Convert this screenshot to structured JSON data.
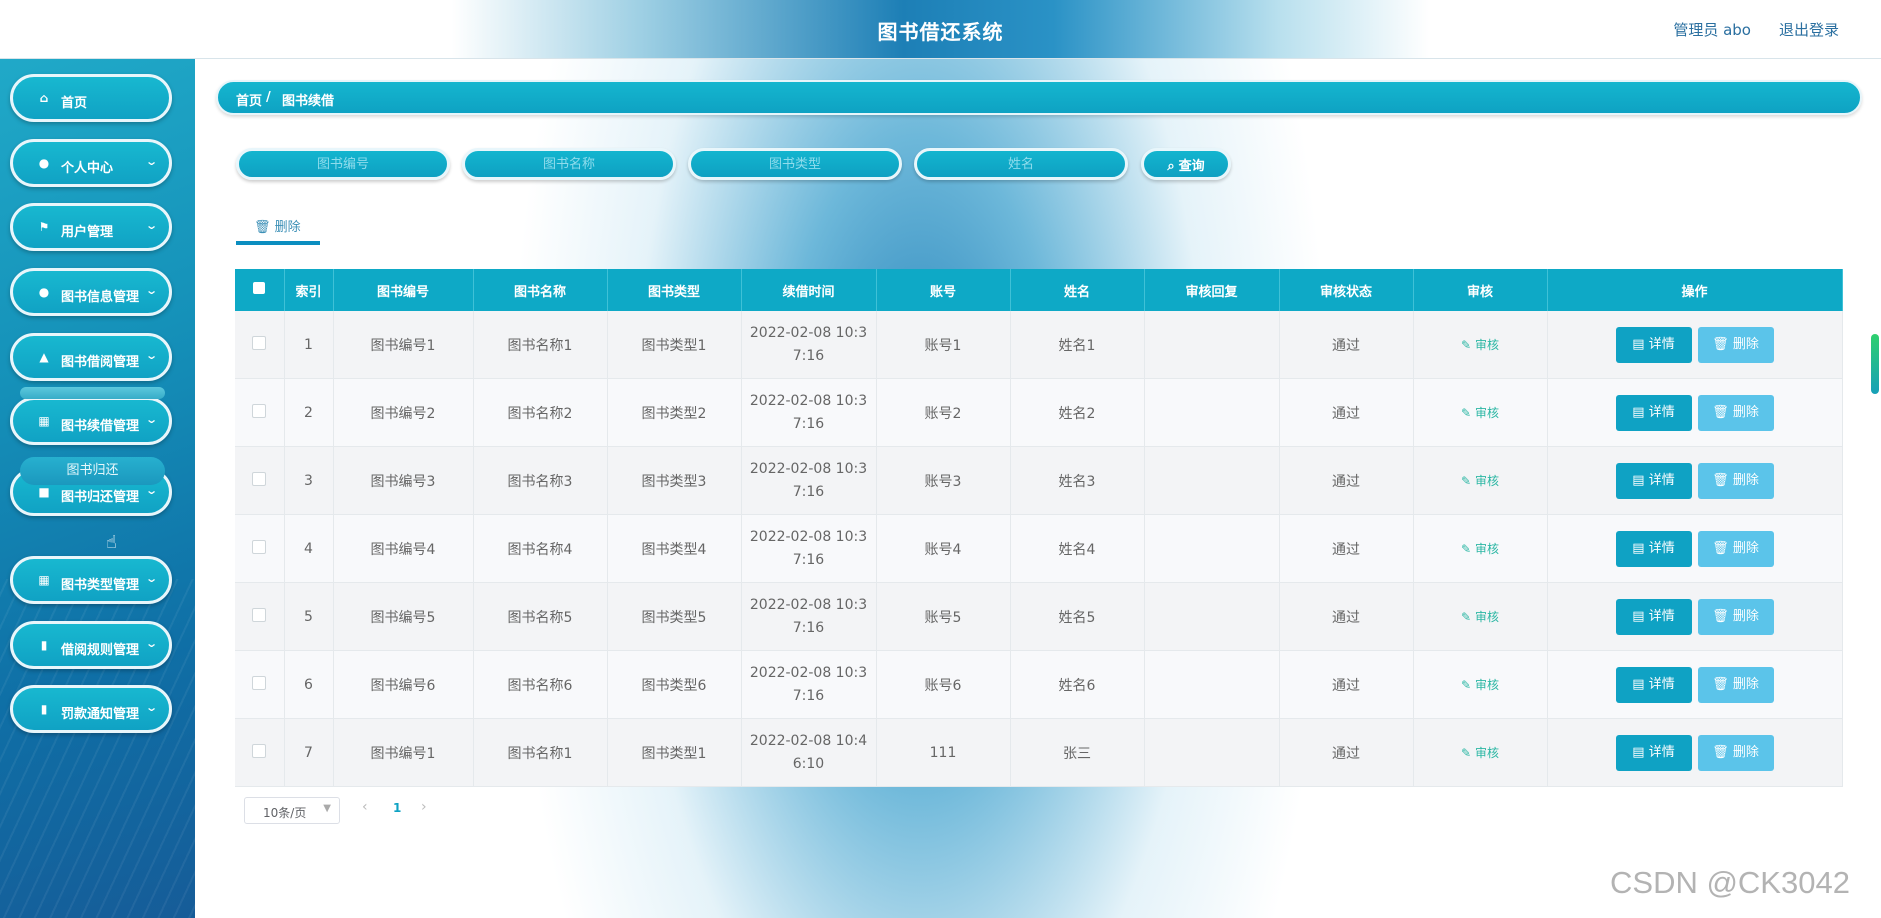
{
  "header": {
    "title": "图书借还系统",
    "user": "管理员 abo",
    "logout": "退出登录"
  },
  "sidebar": {
    "items": [
      {
        "label": "首页",
        "icon": "home-icon",
        "glyph": "⌂",
        "arrow": false
      },
      {
        "label": "个人中心",
        "icon": "user-icon",
        "glyph": "●",
        "arrow": true
      },
      {
        "label": "用户管理",
        "icon": "flag-icon",
        "glyph": "⚑",
        "arrow": true
      },
      {
        "label": "图书信息管理",
        "icon": "location-icon",
        "glyph": "●",
        "arrow": true
      },
      {
        "label": "图书借阅管理",
        "icon": "stamp-icon",
        "glyph": "▲",
        "arrow": true
      },
      {
        "label": "图书续借管理",
        "icon": "grid-icon",
        "glyph": "▦",
        "arrow": true
      },
      {
        "label": "图书归还管理",
        "icon": "chat-icon",
        "glyph": "■",
        "arrow": true
      },
      {
        "label": "图书类型管理",
        "icon": "grid-icon",
        "glyph": "▦",
        "arrow": true
      },
      {
        "label": "借阅规则管理",
        "icon": "clipboard-icon",
        "glyph": "▮",
        "arrow": true
      },
      {
        "label": "罚款通知管理",
        "icon": "chart-icon",
        "glyph": "▮",
        "arrow": true
      }
    ],
    "submenu_label": "图书归还"
  },
  "breadcrumb": {
    "home": "首页",
    "sep": "/",
    "current": "图书续借"
  },
  "search": {
    "book_no_placeholder": "图书编号",
    "book_name_placeholder": "图书名称",
    "book_type_placeholder": "图书类型",
    "name_placeholder": "姓名",
    "query_label": "查询"
  },
  "toolbar": {
    "delete_label": "删除"
  },
  "table": {
    "headers": [
      "索引",
      "图书编号",
      "图书名称",
      "图书类型",
      "续借时间",
      "账号",
      "姓名",
      "审核回复",
      "审核状态",
      "审核",
      "操作"
    ],
    "rows": [
      {
        "index": "1",
        "book_no": "图书编号1",
        "book_name": "图书名称1",
        "book_type": "图书类型1",
        "time_a": "2022-02-08 10:3",
        "time_b": "7:16",
        "account": "账号1",
        "name": "姓名1",
        "reply": "",
        "status": "通过"
      },
      {
        "index": "2",
        "book_no": "图书编号2",
        "book_name": "图书名称2",
        "book_type": "图书类型2",
        "time_a": "2022-02-08 10:3",
        "time_b": "7:16",
        "account": "账号2",
        "name": "姓名2",
        "reply": "",
        "status": "通过"
      },
      {
        "index": "3",
        "book_no": "图书编号3",
        "book_name": "图书名称3",
        "book_type": "图书类型3",
        "time_a": "2022-02-08 10:3",
        "time_b": "7:16",
        "account": "账号3",
        "name": "姓名3",
        "reply": "",
        "status": "通过"
      },
      {
        "index": "4",
        "book_no": "图书编号4",
        "book_name": "图书名称4",
        "book_type": "图书类型4",
        "time_a": "2022-02-08 10:3",
        "time_b": "7:16",
        "account": "账号4",
        "name": "姓名4",
        "reply": "",
        "status": "通过"
      },
      {
        "index": "5",
        "book_no": "图书编号5",
        "book_name": "图书名称5",
        "book_type": "图书类型5",
        "time_a": "2022-02-08 10:3",
        "time_b": "7:16",
        "account": "账号5",
        "name": "姓名5",
        "reply": "",
        "status": "通过"
      },
      {
        "index": "6",
        "book_no": "图书编号6",
        "book_name": "图书名称6",
        "book_type": "图书类型6",
        "time_a": "2022-02-08 10:3",
        "time_b": "7:16",
        "account": "账号6",
        "name": "姓名6",
        "reply": "",
        "status": "通过"
      },
      {
        "index": "7",
        "book_no": "图书编号1",
        "book_name": "图书名称1",
        "book_type": "图书类型1",
        "time_a": "2022-02-08 10:4",
        "time_b": "6:10",
        "account": "111",
        "name": "张三",
        "reply": "",
        "status": "通过"
      }
    ],
    "audit_label": "审核",
    "detail_label": "详情",
    "delete_label": "删除"
  },
  "pagination": {
    "page_size": "10条/页",
    "current_page": "1",
    "prev": "‹",
    "next": "›"
  },
  "watermark": "CSDN @CK3042",
  "colors": {
    "accent": "#0ea9c6",
    "sidebar": "#1591b9",
    "detail_btn": "#0fa2c4",
    "delete_btn": "#5bc4ea",
    "audit": "#2cb7a4"
  }
}
